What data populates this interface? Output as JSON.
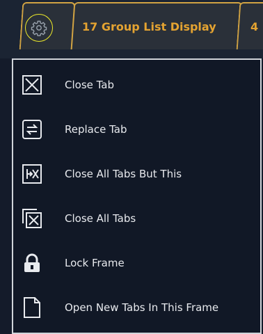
{
  "tabs": {
    "gear_tab_icon": "gear-icon",
    "active_tab_label": "17 Group List Display",
    "next_tab_label": "4",
    "accent_color": "#e4a331",
    "tab_border_color": "#d1a343"
  },
  "context_menu": {
    "items": [
      {
        "label": "Close Tab",
        "icon": "close-tab-icon"
      },
      {
        "label": "Replace Tab",
        "icon": "replace-tab-icon"
      },
      {
        "label": "Close All Tabs But This",
        "icon": "close-all-but-this-icon"
      },
      {
        "label": "Close All Tabs",
        "icon": "close-all-tabs-icon"
      },
      {
        "label": "Lock Frame",
        "icon": "lock-icon"
      },
      {
        "label": "Open New Tabs In This Frame",
        "icon": "new-page-icon"
      }
    ]
  }
}
